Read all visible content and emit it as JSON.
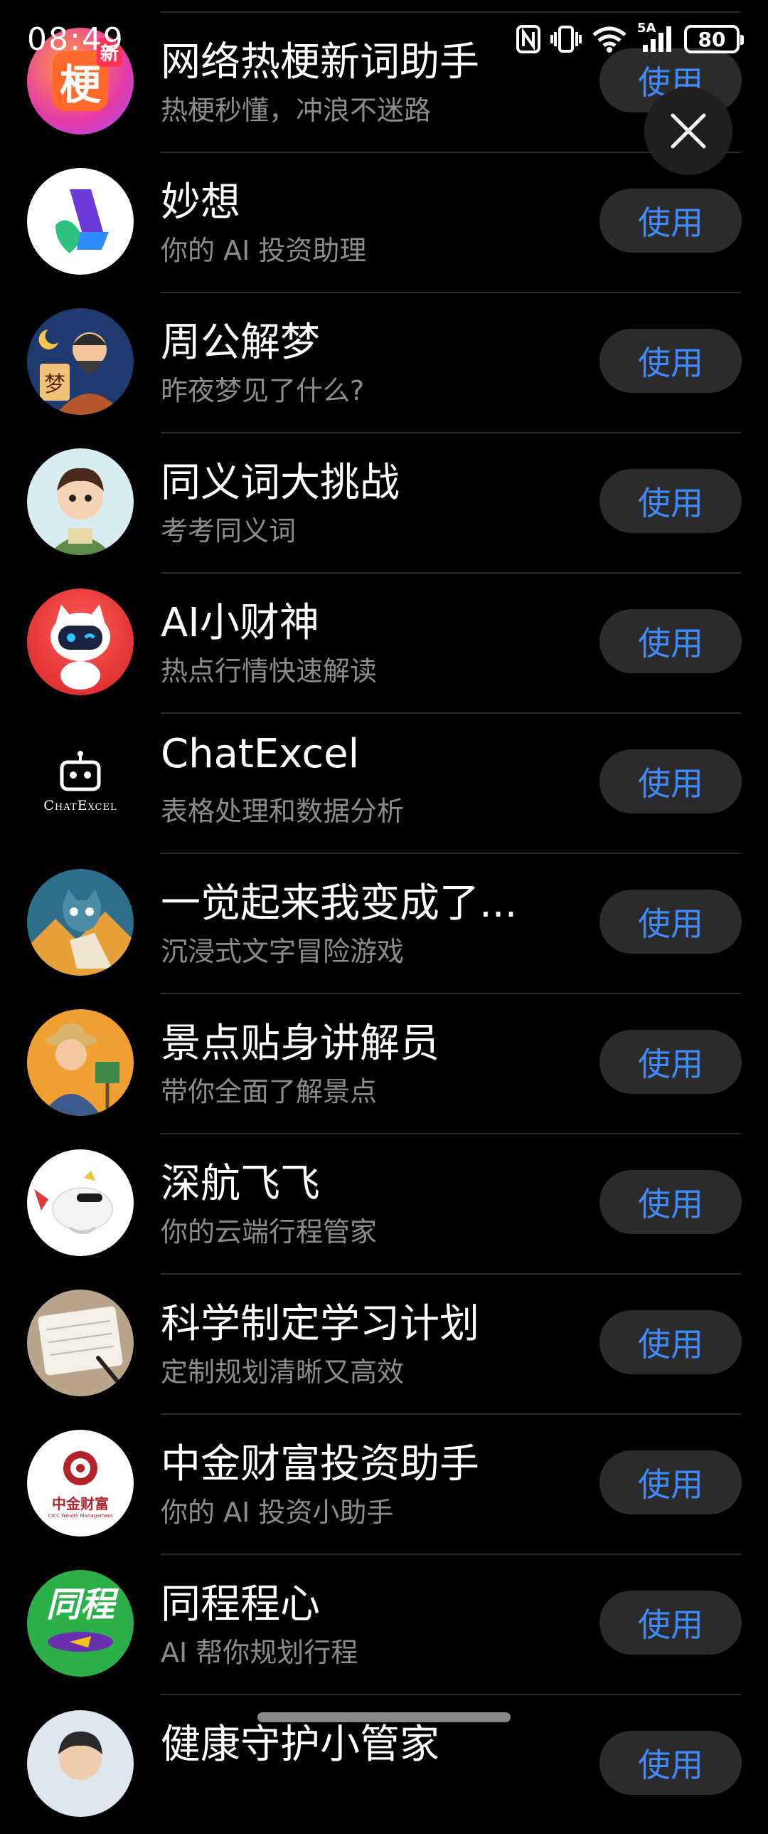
{
  "status_bar": {
    "time": "08:49",
    "battery": "80",
    "network": "5A"
  },
  "close_label": "×",
  "accent_color": "#3f8bff",
  "items": [
    {
      "title": "网络热梗新词助手",
      "subtitle": "热梗秒懂，冲浪不迷路",
      "button": "使用",
      "icon": "meme-icon"
    },
    {
      "title": "妙想",
      "subtitle": "你的 AI 投资助理",
      "button": "使用",
      "icon": "miaoxiang-logo-icon"
    },
    {
      "title": "周公解梦",
      "subtitle": "昨夜梦见了什么?",
      "button": "使用",
      "icon": "dream-sage-icon"
    },
    {
      "title": "同义词大挑战",
      "subtitle": "考考同义词",
      "button": "使用",
      "icon": "student-boy-icon"
    },
    {
      "title": "AI小财神",
      "subtitle": "热点行情快速解读",
      "button": "使用",
      "icon": "robot-cat-icon"
    },
    {
      "title": "ChatExcel",
      "subtitle": "表格处理和数据分析",
      "button": "使用",
      "icon": "chatexcel-logo-icon"
    },
    {
      "title": "一觉起来我变成了...",
      "subtitle": "沉浸式文字冒险游戏",
      "button": "使用",
      "icon": "cat-adventure-icon"
    },
    {
      "title": "景点贴身讲解员",
      "subtitle": "带你全面了解景点",
      "button": "使用",
      "icon": "tour-guide-icon"
    },
    {
      "title": "深航飞飞",
      "subtitle": "你的云端行程管家",
      "button": "使用",
      "icon": "airplane-mascot-icon"
    },
    {
      "title": "科学制定学习计划",
      "subtitle": "定制规划清晰又高效",
      "button": "使用",
      "icon": "study-plan-icon"
    },
    {
      "title": "中金财富投资助手",
      "subtitle": "你的 AI 投资小助手",
      "button": "使用",
      "icon": "cicc-logo-icon"
    },
    {
      "title": "同程程心",
      "subtitle": "AI 帮你规划行程",
      "button": "使用",
      "icon": "tongcheng-logo-icon"
    },
    {
      "title": "健康守护小管家",
      "subtitle": "",
      "button": "使用",
      "icon": "doctor-avatar-icon"
    }
  ],
  "avatar_text": {
    "meme": "梗",
    "meme_badge": "新",
    "dream": "梦",
    "chatexcel": "ChatExcel",
    "cicc": "中金财富",
    "cicc_en": "CICC Wealth Management",
    "tongcheng": "同程"
  }
}
